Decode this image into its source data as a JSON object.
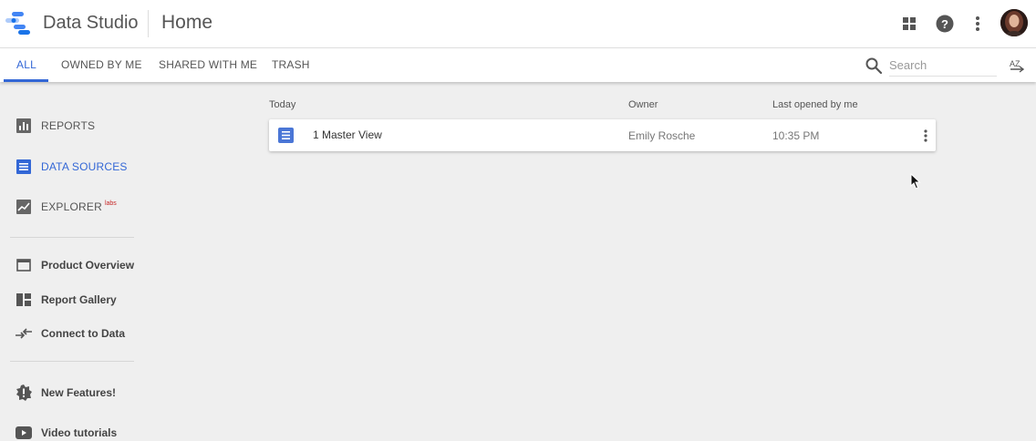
{
  "header": {
    "app_name": "Data Studio",
    "page_title": "Home",
    "brand_colors": [
      "#4285f4",
      "#aecbfa",
      "#1a73e8"
    ]
  },
  "tabs": [
    {
      "label": "ALL",
      "active": true
    },
    {
      "label": "OWNED BY ME",
      "active": false
    },
    {
      "label": "SHARED WITH ME",
      "active": false
    },
    {
      "label": "TRASH",
      "active": false
    }
  ],
  "search": {
    "placeholder": "Search"
  },
  "sort": {
    "label": "AZ"
  },
  "sidebar": {
    "primary": [
      {
        "label": "REPORTS",
        "icon": "bar-chart-icon",
        "active": false
      },
      {
        "label": "DATA SOURCES",
        "icon": "list-icon",
        "active": true
      },
      {
        "label": "EXPLORER",
        "badge": "labs",
        "icon": "line-chart-icon",
        "active": false
      }
    ],
    "secondary": [
      {
        "label": "Product Overview",
        "icon": "window-icon"
      },
      {
        "label": "Report Gallery",
        "icon": "gallery-icon"
      },
      {
        "label": "Connect to Data",
        "icon": "connect-arrows-icon"
      }
    ],
    "tertiary": [
      {
        "label": "New Features!",
        "icon": "new-badge-icon"
      },
      {
        "label": "Video tutorials",
        "icon": "youtube-icon"
      }
    ]
  },
  "list": {
    "columns": {
      "name": "Today",
      "owner": "Owner",
      "last_opened": "Last opened by me"
    },
    "rows": [
      {
        "name": "1 Master View",
        "owner": "Emily Rosche",
        "last_opened": "10:35 PM"
      }
    ]
  },
  "colors": {
    "accent": "#3367d6",
    "background": "#efefef",
    "file_icon": "#4a76d6"
  }
}
